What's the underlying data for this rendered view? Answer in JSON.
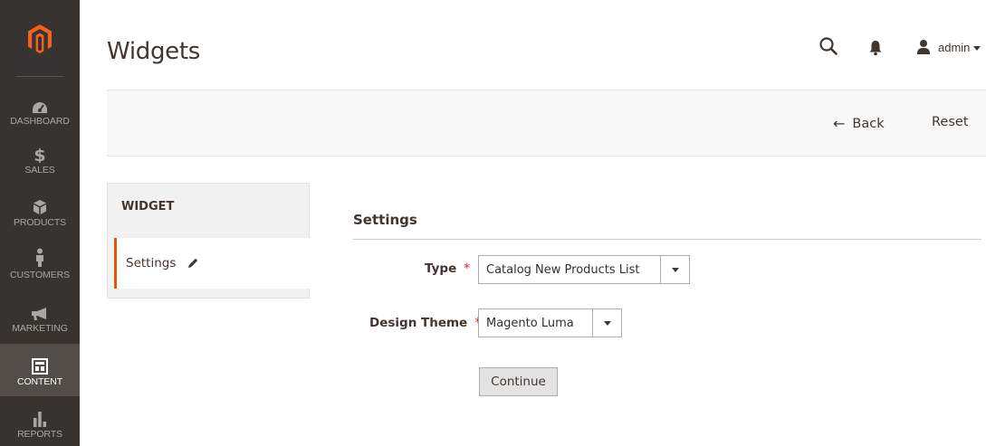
{
  "sidebar": {
    "logo": "magento-logo-icon",
    "items": [
      {
        "label": "DASHBOARD",
        "icon": "dashboard-gauge-icon"
      },
      {
        "label": "SALES",
        "icon": "dollar-icon"
      },
      {
        "label": "PRODUCTS",
        "icon": "cube-icon"
      },
      {
        "label": "CUSTOMERS",
        "icon": "person-icon"
      },
      {
        "label": "MARKETING",
        "icon": "megaphone-icon"
      },
      {
        "label": "CONTENT",
        "icon": "layout-icon"
      },
      {
        "label": "REPORTS",
        "icon": "bar-chart-icon"
      }
    ],
    "active": "CONTENT"
  },
  "header": {
    "title": "Widgets",
    "user": "admin"
  },
  "actions": {
    "back_label": "Back",
    "reset_label": "Reset"
  },
  "tabs": {
    "heading": "WIDGET",
    "items": [
      {
        "label": "Settings"
      }
    ]
  },
  "form": {
    "section_title": "Settings",
    "type_label": "Type",
    "type_value": "Catalog New Products List",
    "theme_label": "Design Theme",
    "theme_value": "Magento Luma",
    "required_mark": "*",
    "continue_label": "Continue"
  },
  "colors": {
    "sidebar_bg": "#373330",
    "active_bg": "#524d49",
    "accent": "#eb5202",
    "required": "#e22626"
  }
}
